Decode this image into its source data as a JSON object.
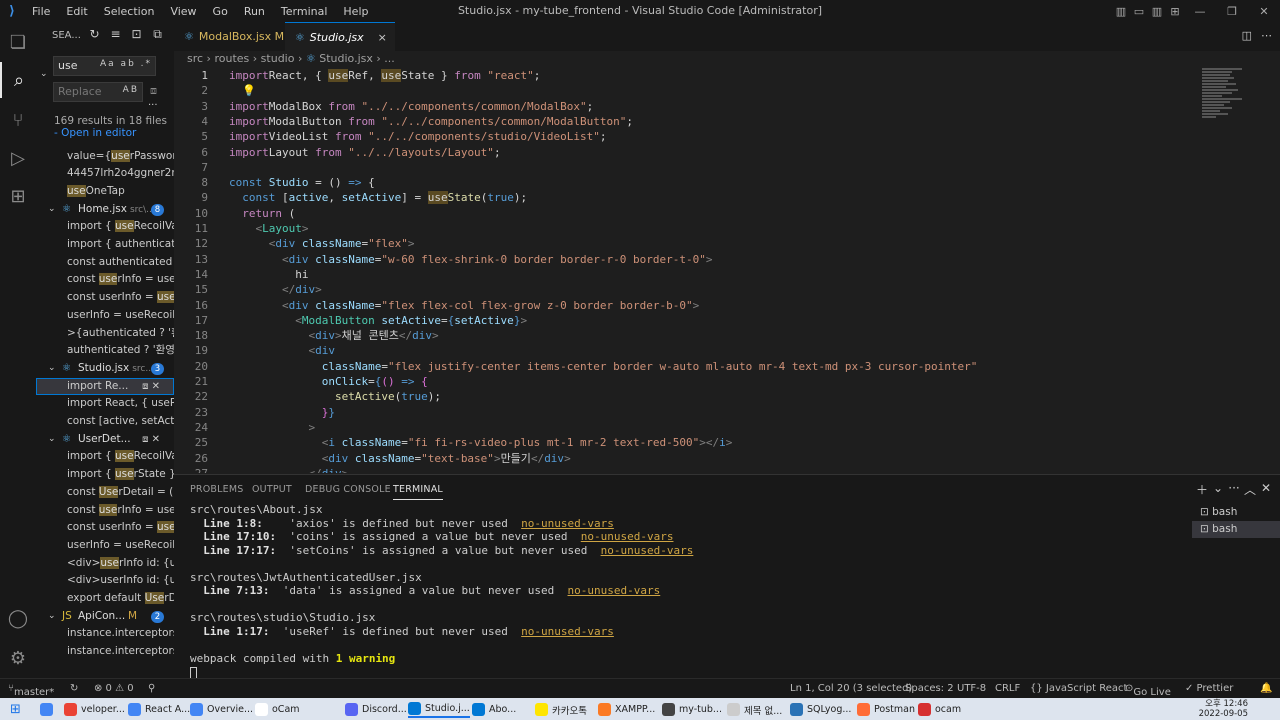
{
  "titlebar": {
    "menu": [
      "File",
      "Edit",
      "Selection",
      "View",
      "Go",
      "Run",
      "Terminal",
      "Help"
    ],
    "title": "Studio.jsx - my-tube_frontend - Visual Studio Code [Administrator]"
  },
  "activity": [
    "explorer-icon",
    "search-icon",
    "source-control-icon",
    "run-debug-icon",
    "extensions-icon",
    "account-icon",
    "settings-icon"
  ],
  "sidebar": {
    "header": "SEA...",
    "search_value": "use",
    "search_options": "Aa ab .*",
    "replace_placeholder": "Replace",
    "replace_option": "AB",
    "results_text": "169 results in 18 files",
    "open_in_editor": "- Open in editor",
    "rows": [
      {
        "kind": "match",
        "pre": "value={",
        "hl": "use",
        "post": "rPassword}"
      },
      {
        "kind": "match",
        "pre": "44457lrh2o4ggner2r...",
        "hl": "",
        "post": ""
      },
      {
        "kind": "match",
        "pre": "",
        "hl": "use",
        "post": "OneTap"
      },
      {
        "kind": "file",
        "name": "Home.jsx",
        "path": "src\\...",
        "badge": "8"
      },
      {
        "kind": "match",
        "pre": "import { ",
        "hl": "use",
        "post": "RecoilVal..."
      },
      {
        "kind": "match",
        "pre": "import { authenticate...",
        "hl": "",
        "post": ""
      },
      {
        "kind": "match",
        "pre": "const authenticated ...",
        "hl": "",
        "post": ""
      },
      {
        "kind": "match",
        "pre": "const ",
        "hl": "use",
        "post": "rInfo = use..."
      },
      {
        "kind": "match",
        "pre": "const userInfo = ",
        "hl": "use",
        "post": "..."
      },
      {
        "kind": "match",
        "pre": "userInfo = useRecoil...",
        "hl": "",
        "post": ""
      },
      {
        "kind": "match",
        "pre": ">{authenticated ? '환...",
        "hl": "",
        "post": ""
      },
      {
        "kind": "match",
        "pre": "authenticated ? '환영...",
        "hl": "",
        "post": ""
      },
      {
        "kind": "file",
        "name": "Studio.jsx",
        "path": "src...",
        "badge": "3"
      },
      {
        "kind": "match",
        "pre": "import Re...",
        "hl": "",
        "post": "",
        "selected": true
      },
      {
        "kind": "match",
        "pre": "import React, { useRe...",
        "hl": "",
        "post": ""
      },
      {
        "kind": "match",
        "pre": "const [active, setActi...",
        "hl": "",
        "post": ""
      },
      {
        "kind": "file",
        "name": "UserDet...",
        "path": "",
        "badge": ""
      },
      {
        "kind": "match",
        "pre": "import { ",
        "hl": "use",
        "post": "RecoilVal..."
      },
      {
        "kind": "match",
        "pre": "import { ",
        "hl": "use",
        "post": "rState } f..."
      },
      {
        "kind": "match",
        "pre": "const ",
        "hl": "Use",
        "post": "rDetail = () ..."
      },
      {
        "kind": "match",
        "pre": "const ",
        "hl": "use",
        "post": "rInfo = use..."
      },
      {
        "kind": "match",
        "pre": "const userInfo = ",
        "hl": "use",
        "post": "..."
      },
      {
        "kind": "match",
        "pre": "userInfo = useRecoil...",
        "hl": "",
        "post": ""
      },
      {
        "kind": "match",
        "pre": "<div>",
        "hl": "use",
        "post": "rInfo id: {us..."
      },
      {
        "kind": "match",
        "pre": "<div>userInfo id: {us...",
        "hl": "",
        "post": ""
      },
      {
        "kind": "match",
        "pre": "export default ",
        "hl": "Use",
        "post": "rD..."
      },
      {
        "kind": "file",
        "name": "ApiCon...",
        "path": "",
        "badge": "2",
        "js": true,
        "mod": "M"
      },
      {
        "kind": "match",
        "pre": "instance.interceptors...",
        "hl": "",
        "post": ""
      },
      {
        "kind": "match",
        "pre": "instance.interceptors...",
        "hl": "",
        "post": ""
      }
    ]
  },
  "tabs": [
    {
      "label": "ModalBox.jsx",
      "status": "M"
    },
    {
      "label": "Studio.jsx",
      "close": "×"
    }
  ],
  "breadcrumb": [
    "src",
    "routes",
    "studio",
    "Studio.jsx",
    "..."
  ],
  "editor": {
    "lines": [
      [
        [
          "k",
          "import"
        ],
        [
          "",
          "React, { "
        ],
        [
          "m",
          "use"
        ],
        [
          "",
          "Ref, "
        ],
        [
          "m",
          "use"
        ],
        [
          "",
          "State } "
        ],
        [
          "k",
          "from"
        ],
        [
          "s",
          " \"react\""
        ],
        [
          "",
          ";"
        ]
      ],
      [
        [
          "f",
          "  💡"
        ]
      ],
      [
        [
          "k",
          "import"
        ],
        [
          "",
          "ModalBox "
        ],
        [
          "k",
          "from"
        ],
        [
          "s",
          " \"../../components/common/ModalBox\""
        ],
        [
          "",
          ";"
        ]
      ],
      [
        [
          "k",
          "import"
        ],
        [
          "",
          "ModalButton "
        ],
        [
          "k",
          "from"
        ],
        [
          "s",
          " \"../../components/common/ModalButton\""
        ],
        [
          "",
          ";"
        ]
      ],
      [
        [
          "k",
          "import"
        ],
        [
          "",
          "VideoList "
        ],
        [
          "k",
          "from"
        ],
        [
          "s",
          " \"../../components/studio/VideoList\""
        ],
        [
          "",
          ";"
        ]
      ],
      [
        [
          "k",
          "import"
        ],
        [
          "",
          "Layout "
        ],
        [
          "k",
          "from"
        ],
        [
          "s",
          " \"../../layouts/Layout\""
        ],
        [
          "",
          ";"
        ]
      ],
      [
        [
          "",
          ""
        ]
      ],
      [
        [
          "b",
          "const"
        ],
        [
          "v",
          " Studio"
        ],
        [
          "",
          " = () "
        ],
        [
          "b",
          "=>"
        ],
        [
          "",
          " {"
        ]
      ],
      [
        [
          "",
          "  "
        ],
        [
          "b",
          "const"
        ],
        [
          "",
          " ["
        ],
        [
          "v",
          "active"
        ],
        [
          "",
          ", "
        ],
        [
          "v",
          "setActive"
        ],
        [
          "",
          "] = "
        ],
        [
          "m",
          "use"
        ],
        [
          "f",
          "State"
        ],
        [
          "",
          "("
        ],
        [
          "b",
          "true"
        ],
        [
          "",
          ");"
        ]
      ],
      [
        [
          "",
          "  "
        ],
        [
          "k",
          "return"
        ],
        [
          "",
          " ("
        ]
      ],
      [
        [
          "g",
          "    <"
        ],
        [
          "t",
          "Layout"
        ],
        [
          "g",
          ">"
        ]
      ],
      [
        [
          "g",
          "      <"
        ],
        [
          "b",
          "div"
        ],
        [
          "v",
          " className"
        ],
        [
          "",
          "="
        ],
        [
          "s",
          "\"flex\""
        ],
        [
          "g",
          ">"
        ]
      ],
      [
        [
          "g",
          "        <"
        ],
        [
          "b",
          "div"
        ],
        [
          "v",
          " className"
        ],
        [
          "",
          "="
        ],
        [
          "s",
          "\"w-60 flex-shrink-0 border border-r-0 border-t-0\""
        ],
        [
          "g",
          ">"
        ]
      ],
      [
        [
          "",
          "          hi"
        ]
      ],
      [
        [
          "g",
          "        </"
        ],
        [
          "b",
          "div"
        ],
        [
          "g",
          ">"
        ]
      ],
      [
        [
          "g",
          "        <"
        ],
        [
          "b",
          "div"
        ],
        [
          "v",
          " className"
        ],
        [
          "",
          "="
        ],
        [
          "s",
          "\"flex flex-col flex-grow z-0 border border-b-0\""
        ],
        [
          "g",
          ">"
        ]
      ],
      [
        [
          "g",
          "          <"
        ],
        [
          "t",
          "ModalButton"
        ],
        [
          "v",
          " setActive"
        ],
        [
          "",
          "="
        ],
        [
          "b",
          "{"
        ],
        [
          "v",
          "setActive"
        ],
        [
          "b",
          "}"
        ],
        [
          "g",
          ">"
        ]
      ],
      [
        [
          "g",
          "            <"
        ],
        [
          "b",
          "div"
        ],
        [
          "g",
          ">"
        ],
        [
          "",
          "채널 콘텐츠"
        ],
        [
          "g",
          "</"
        ],
        [
          "b",
          "div"
        ],
        [
          "g",
          ">"
        ]
      ],
      [
        [
          "g",
          "            <"
        ],
        [
          "b",
          "div"
        ]
      ],
      [
        [
          "v",
          "              className"
        ],
        [
          "",
          "="
        ],
        [
          "s",
          "\"flex justify-center items-center border w-auto ml-auto mr-4 text-md px-3 cursor-pointer\""
        ]
      ],
      [
        [
          "v",
          "              onClick"
        ],
        [
          "",
          "="
        ],
        [
          "b",
          "{"
        ],
        [
          "p",
          "()"
        ],
        [
          "",
          " "
        ],
        [
          "b",
          "=>"
        ],
        [
          "",
          " "
        ],
        [
          "p",
          "{"
        ]
      ],
      [
        [
          "f",
          "                setActive"
        ],
        [
          "",
          "("
        ],
        [
          "b",
          "true"
        ],
        [
          "",
          ");"
        ]
      ],
      [
        [
          "p",
          "              }"
        ],
        [
          "b",
          "}"
        ]
      ],
      [
        [
          "g",
          "            >"
        ]
      ],
      [
        [
          "g",
          "              <"
        ],
        [
          "b",
          "i"
        ],
        [
          "v",
          " className"
        ],
        [
          "",
          "="
        ],
        [
          "s",
          "\"fi fi-rs-video-plus mt-1 mr-2 text-red-500\""
        ],
        [
          "g",
          "></"
        ],
        [
          "b",
          "i"
        ],
        [
          "g",
          ">"
        ]
      ],
      [
        [
          "g",
          "              <"
        ],
        [
          "b",
          "div"
        ],
        [
          "v",
          " className"
        ],
        [
          "",
          "="
        ],
        [
          "s",
          "\"text-base\""
        ],
        [
          "g",
          ">"
        ],
        [
          "",
          "만들기"
        ],
        [
          "g",
          "</"
        ],
        [
          "b",
          "div"
        ],
        [
          "g",
          ">"
        ]
      ],
      [
        [
          "g",
          "            </"
        ],
        [
          "b",
          "div"
        ],
        [
          "g",
          ">"
        ]
      ]
    ]
  },
  "panel": {
    "tabs": [
      "PROBLEMS",
      "OUTPUT",
      "DEBUG CONSOLE",
      "TERMINAL"
    ],
    "active_tab": "TERMINAL",
    "terminal": [
      {
        "text": "src\\routes\\About.jsx"
      },
      {
        "loc": "  Line 1:8:",
        "msg": "'axios' is defined but never used",
        "rule": "no-unused-vars",
        "pad": "    "
      },
      {
        "loc": "  Line 17:10:",
        "msg": "'coins' is assigned a value but never used",
        "rule": "no-unused-vars",
        "pad": "  "
      },
      {
        "loc": "  Line 17:17:",
        "msg": "'setCoins' is assigned a value but never used",
        "rule": "no-unused-vars",
        "pad": "  "
      },
      {
        "text": ""
      },
      {
        "text": "src\\routes\\JwtAuthenticatedUser.jsx"
      },
      {
        "loc": "  Line 7:13:",
        "msg": "'data' is assigned a value but never used",
        "rule": "no-unused-vars",
        "pad": "  "
      },
      {
        "text": ""
      },
      {
        "text": "src\\routes\\studio\\Studio.jsx"
      },
      {
        "loc": "  Line 1:17:",
        "msg": "'useRef' is defined but never used",
        "rule": "no-unused-vars",
        "pad": "  "
      },
      {
        "text": ""
      },
      {
        "compiled_pre": "webpack compiled with ",
        "compiled_warn": "1 warning"
      }
    ],
    "shells": [
      "bash",
      "bash"
    ]
  },
  "status": {
    "branch": "master*",
    "errors": "⊗ 0 ⚠ 0",
    "position": "Ln 1, Col 20 (3 selected)",
    "spaces": "Spaces: 2",
    "encoding": "UTF-8",
    "eol": "CRLF",
    "language": "{} JavaScript React",
    "golive": "Go Live",
    "prettier": "✓ Prettier"
  },
  "taskbar": {
    "items": [
      "veloper...",
      "React A...",
      "Overvie...",
      "oCam",
      "Discord...",
      "Studio.j...",
      "Abo...",
      "카카오톡",
      "XAMPP...",
      "my-tub...",
      "제목 없...",
      "SQLyog...",
      "Postman",
      "ocam"
    ],
    "colors": [
      "#4285f4",
      "#ea4335",
      "#4285f4",
      "#4285f4",
      "#ffffff",
      "#5865f2",
      "#0078d4",
      "#0078d4",
      "#fee500",
      "#fb7a24",
      "#444444",
      "#cccccc",
      "#2a72b5",
      "#ff6c37",
      "#d63030"
    ],
    "time": "오후 12:46",
    "date": "2022-09-05"
  }
}
